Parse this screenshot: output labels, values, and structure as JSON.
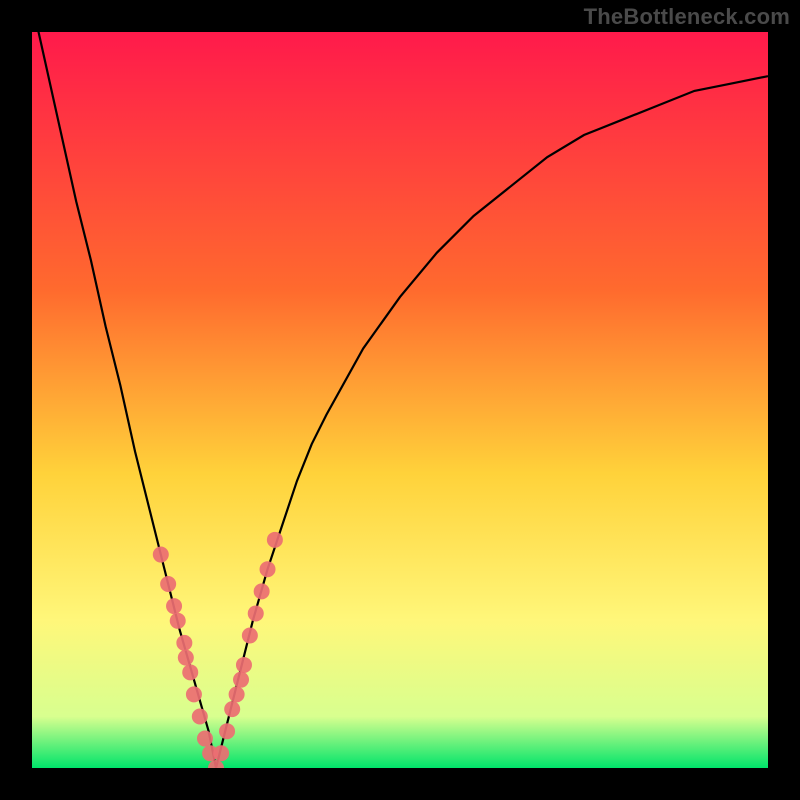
{
  "watermark": "TheBottleneck.com",
  "colors": {
    "frame": "#000000",
    "curve": "#000000",
    "dot_fill": "#eb6e72",
    "grad_top": "#ff1a4b",
    "grad_mid1": "#ff6a2e",
    "grad_mid2": "#ffd23a",
    "grad_mid3": "#fff77a",
    "grad_mid4": "#d8ff8f",
    "grad_bottom": "#00e46a"
  },
  "chart_data": {
    "type": "line",
    "title": "",
    "xlabel": "",
    "ylabel": "",
    "xlim": [
      0,
      100
    ],
    "ylim": [
      0,
      100
    ],
    "x_min_index": 25,
    "curve": {
      "x": [
        0,
        2,
        4,
        6,
        8,
        10,
        12,
        14,
        16,
        18,
        20,
        22,
        24,
        25,
        26,
        28,
        30,
        32,
        34,
        36,
        38,
        40,
        45,
        50,
        55,
        60,
        65,
        70,
        75,
        80,
        85,
        90,
        95,
        100
      ],
      "y": [
        104,
        95,
        86,
        77,
        69,
        60,
        52,
        43,
        35,
        27,
        19,
        12,
        5,
        0,
        4,
        12,
        20,
        27,
        33,
        39,
        44,
        48,
        57,
        64,
        70,
        75,
        79,
        83,
        86,
        88,
        90,
        92,
        93,
        94
      ]
    },
    "dots": {
      "x": [
        17.5,
        18.5,
        19.3,
        19.8,
        20.7,
        20.9,
        21.5,
        22.0,
        22.8,
        23.5,
        24.2,
        25.0,
        25.7,
        26.5,
        27.2,
        27.8,
        28.4,
        28.8,
        29.6,
        30.4,
        31.2,
        32.0,
        33.0
      ],
      "y": [
        29,
        25,
        22,
        20,
        17,
        15,
        13,
        10,
        7,
        4,
        2,
        0,
        2,
        5,
        8,
        10,
        12,
        14,
        18,
        21,
        24,
        27,
        31
      ]
    }
  }
}
